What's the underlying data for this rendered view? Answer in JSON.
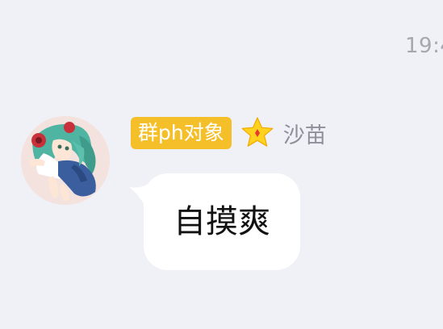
{
  "chat": {
    "timestamp": "19:4",
    "message": {
      "group_title": "群ph对象",
      "badge_color": "#f5bf2a",
      "level_icon": "star-icon",
      "sender_name": "沙苗",
      "text": "自摸爽",
      "avatar_icon": "anime-girl-avatar"
    }
  }
}
